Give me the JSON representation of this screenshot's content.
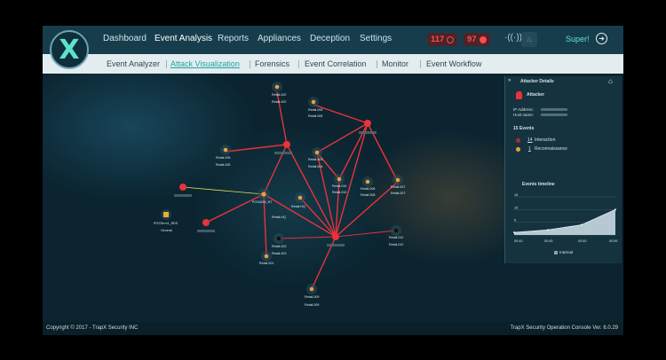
{
  "brand": {
    "logo_letter": "X"
  },
  "nav": {
    "items": [
      "Dashboard",
      "Event Analysis",
      "Reports",
      "Appliances",
      "Deception",
      "Settings"
    ],
    "active": "Event Analysis"
  },
  "alerts": {
    "count_a": "117",
    "count_b": "97"
  },
  "user": {
    "name": "Super!"
  },
  "subnav": {
    "items": [
      "Event Analyzer",
      "Attack Visualization",
      "Forensics",
      "Event Correlation",
      "Monitor",
      "Event Workflow"
    ],
    "active": "Attack Visualization"
  },
  "graph": {
    "labels": {
      "n1": "Retail-002",
      "n2": "Retail-006",
      "n3": "Retail-005",
      "n4": "Retail-004",
      "n5": "Retail-010",
      "n6": "Retail-008",
      "n7": "Retail-007",
      "n8": "Retail-HQ",
      "n9": "Retail-003",
      "n10": "Retail-001",
      "n11": "Retail-012",
      "n12": "Retail-009",
      "pos_a": "POSTerm1_RDS",
      "pos_b": "General",
      "posadm_a": "POSADM_NT",
      "posadm_b": "Retail-HQ"
    }
  },
  "colors": {
    "attack_line": "#e8333a",
    "lateral_line": "#e8e05a",
    "attacker": "#e8333a",
    "accent": "#1fa6a0"
  },
  "panel": {
    "title": "Attacker Details",
    "attacker_label": "Attacker",
    "ip_label": "IP Address:",
    "host_label": "Host name:",
    "events_title": "15 Events",
    "interaction_count": "14",
    "interaction_label": "Interaction",
    "recon_count": "1",
    "recon_label": "Reconnaissance",
    "timeline_title": "Events timeline",
    "y_ticks": [
      "15",
      "10",
      "5",
      "0"
    ],
    "x_ticks": [
      "00:40",
      "00:45",
      "00:50",
      "00:55"
    ],
    "legend": "Internal"
  },
  "chart_data": {
    "type": "area",
    "title": "Events timeline",
    "x": [
      "00:40",
      "00:45",
      "00:50",
      "00:55"
    ],
    "series": [
      {
        "name": "Internal",
        "values": [
          1,
          2,
          4,
          10
        ]
      }
    ],
    "ylim": [
      0,
      15
    ],
    "legend": "bottom"
  },
  "footer": {
    "copyright": "Copyright © 2017 - TrapX Security INC",
    "version": "TrapX Security Operation Console Ver. 6.0.29"
  }
}
